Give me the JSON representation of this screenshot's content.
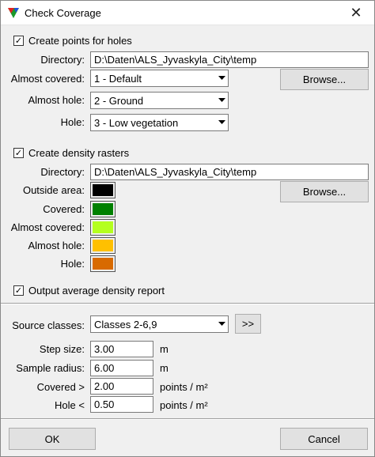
{
  "window": {
    "title": "Check Coverage",
    "close_glyph": "✕"
  },
  "holes": {
    "checkbox_label": "Create points for holes",
    "checked": true,
    "directory_label": "Directory:",
    "directory_value": "D:\\Daten\\ALS_Jyvaskyla_City\\temp",
    "almost_covered_label": "Almost covered:",
    "almost_covered_value": "1 - Default",
    "almost_hole_label": "Almost hole:",
    "almost_hole_value": "2 - Ground",
    "hole_label": "Hole:",
    "hole_value": "3 - Low vegetation",
    "browse_label": "Browse..."
  },
  "density": {
    "checkbox_label": "Create density rasters",
    "checked": true,
    "directory_label": "Directory:",
    "directory_value": "D:\\Daten\\ALS_Jyvaskyla_City\\temp",
    "browse_label": "Browse...",
    "colors": [
      {
        "label": "Outside area:",
        "color": "#000000"
      },
      {
        "label": "Covered:",
        "color": "#008000"
      },
      {
        "label": "Almost covered:",
        "color": "#b4ff1e"
      },
      {
        "label": "Almost hole:",
        "color": "#ffc000"
      },
      {
        "label": "Hole:",
        "color": "#d86a00"
      }
    ]
  },
  "report": {
    "checkbox_label": "Output average density report",
    "checked": true
  },
  "settings": {
    "source_classes_label": "Source classes:",
    "source_classes_value": "Classes 2-6,9",
    "more_button": ">>",
    "step_size_label": "Step size:",
    "step_size_value": "3.00",
    "step_size_unit": "m",
    "sample_radius_label": "Sample radius:",
    "sample_radius_value": "6.00",
    "sample_radius_unit": "m",
    "covered_label": "Covered >",
    "covered_value": "2.00",
    "covered_unit": "points / m²",
    "hole_label": "Hole <",
    "hole_value": "0.50",
    "hole_unit": "points / m²"
  },
  "footer": {
    "ok_label": "OK",
    "cancel_label": "Cancel"
  },
  "check_glyph": "✓"
}
